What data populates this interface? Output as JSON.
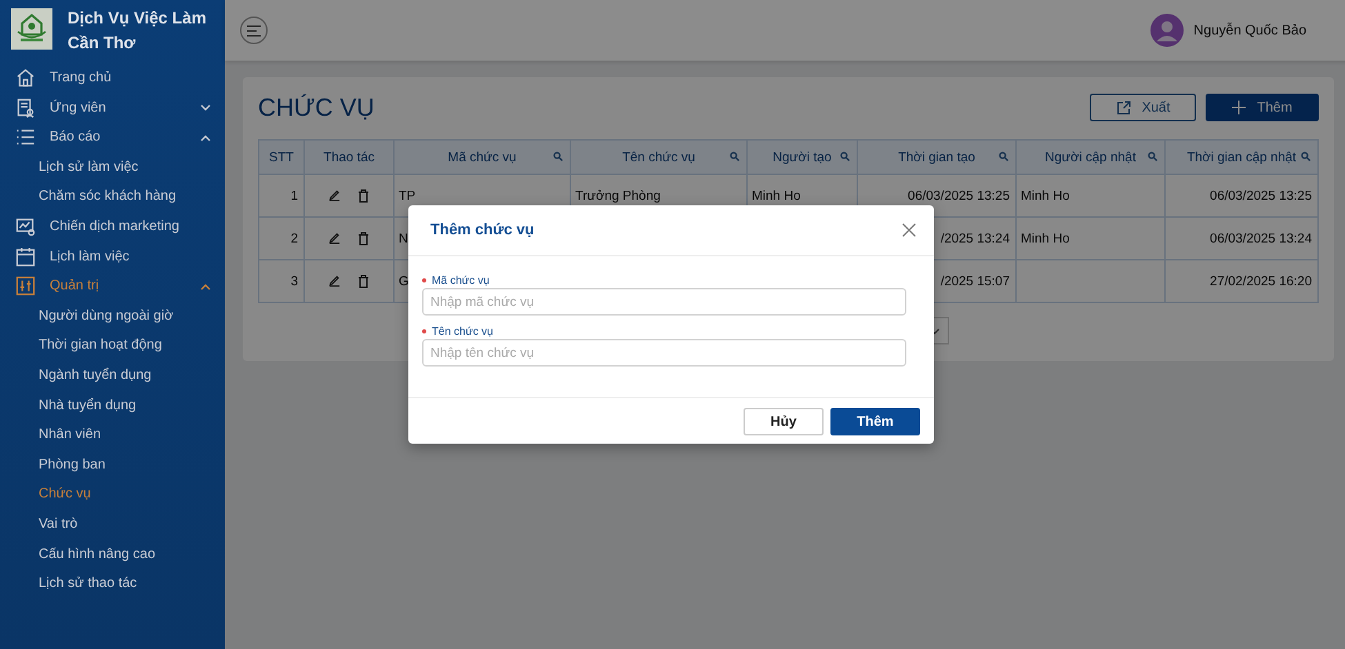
{
  "brand": {
    "title": "Dịch Vụ Việc Làm Cần Thơ"
  },
  "sidebar": {
    "items": [
      {
        "label": "Trang chủ",
        "selected": false
      },
      {
        "label": "Ứng viên",
        "selected": false,
        "expanded": false
      },
      {
        "label": "Báo cáo",
        "selected": false,
        "expanded": true,
        "children": [
          {
            "label": "Lịch sử làm việc",
            "selected": false
          },
          {
            "label": "Chăm sóc khách hàng",
            "selected": false
          }
        ]
      },
      {
        "label": "Chiến dịch marketing",
        "selected": false
      },
      {
        "label": "Lịch làm việc",
        "selected": false
      },
      {
        "label": "Quản trị",
        "selected": true,
        "expanded": true,
        "children": [
          {
            "label": "Người dùng ngoài giờ",
            "selected": false
          },
          {
            "label": "Thời gian hoạt động",
            "selected": false
          },
          {
            "label": "Ngành tuyển dụng",
            "selected": false
          },
          {
            "label": "Nhà tuyển dụng",
            "selected": false
          },
          {
            "label": "Nhân viên",
            "selected": false
          },
          {
            "label": "Phòng ban",
            "selected": false
          },
          {
            "label": "Chức vụ",
            "selected": true
          },
          {
            "label": "Vai trò",
            "selected": false
          },
          {
            "label": "Cấu hình nâng cao",
            "selected": false
          },
          {
            "label": "Lịch sử thao tác",
            "selected": false
          }
        ]
      }
    ]
  },
  "header": {
    "user_name": "Nguyễn Quốc Bảo"
  },
  "page": {
    "title": "CHỨC VỤ",
    "buttons": [
      {
        "label": "Xuất",
        "kind": "outline"
      },
      {
        "label": "Thêm",
        "kind": "primary"
      }
    ]
  },
  "table": {
    "columns": [
      {
        "label": "STT",
        "searchable": false
      },
      {
        "label": "Thao tác",
        "searchable": false
      },
      {
        "label": "Mã chức vụ",
        "searchable": true
      },
      {
        "label": "Tên chức vụ",
        "searchable": true
      },
      {
        "label": "Người tạo",
        "searchable": true
      },
      {
        "label": "Thời gian tạo",
        "searchable": true
      },
      {
        "label": "Người cập nhật",
        "searchable": true
      },
      {
        "label": "Thời gian cập nhật",
        "searchable": true
      }
    ],
    "rows": [
      {
        "stt": "1",
        "code": "TP",
        "name": "Trưởng Phòng",
        "creator": "Minh Ho",
        "created": "06/03/2025 13:25",
        "updater": "Minh Ho",
        "updated": "06/03/2025 13:25"
      },
      {
        "stt": "2",
        "code": "N",
        "created": "/2025 13:24",
        "updater": "Minh Ho",
        "updated": "06/03/2025 13:24"
      },
      {
        "stt": "3",
        "code": "G",
        "created": "/2025 15:07",
        "updated": "27/02/2025 16:20"
      }
    ]
  },
  "dialog": {
    "title": "Thêm chức vụ",
    "fields": [
      {
        "label": "Mã chức vụ",
        "required": true,
        "placeholder": "Nhập mã chức vụ"
      },
      {
        "label": "Tên chức vụ",
        "required": true,
        "placeholder": "Nhập tên chức vụ"
      }
    ],
    "buttons": [
      {
        "label": "Hủy",
        "kind": "secondary"
      },
      {
        "label": "Thêm",
        "kind": "primary"
      }
    ]
  }
}
